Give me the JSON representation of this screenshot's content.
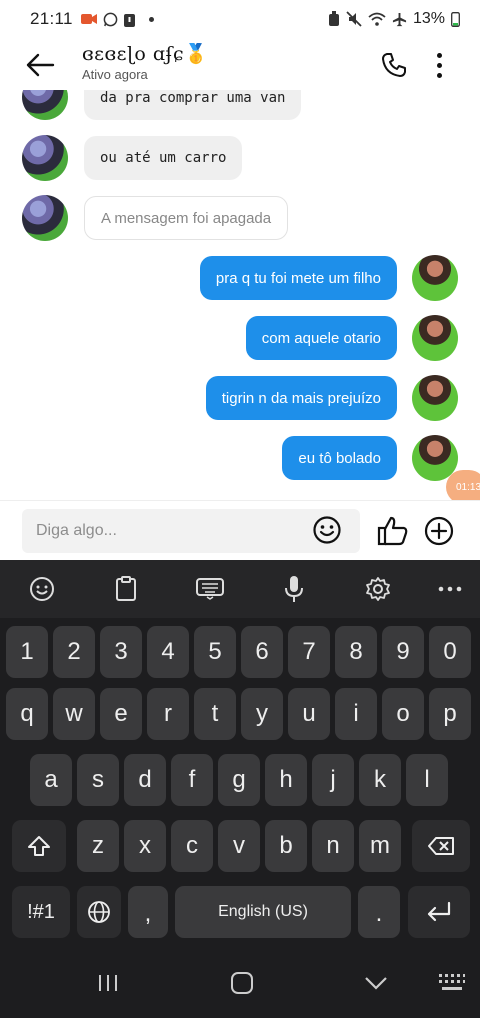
{
  "status": {
    "time": "21:11",
    "battery": "13%"
  },
  "header": {
    "title": "ɞɛɞɛɭo ɑʄɕ🥇",
    "subtitle": "Ativo agora"
  },
  "messages": [
    {
      "dir": "in",
      "text": "da pra comprar uma van"
    },
    {
      "dir": "in",
      "text": "ou até um carro"
    },
    {
      "dir": "in",
      "text": "A mensagem foi apagada",
      "deleted": true
    },
    {
      "dir": "out",
      "text": "pra q tu foi mete um filho"
    },
    {
      "dir": "out",
      "text": "com aquele otario"
    },
    {
      "dir": "out",
      "text": "tigrin n da mais prejuízo"
    },
    {
      "dir": "out",
      "text": "eu tô bolado"
    }
  ],
  "badge": "01:13",
  "composer": {
    "placeholder": "Diga algo..."
  },
  "keyboard": {
    "row_numbers": [
      "1",
      "2",
      "3",
      "4",
      "5",
      "6",
      "7",
      "8",
      "9",
      "0"
    ],
    "row1": [
      "q",
      "w",
      "e",
      "r",
      "t",
      "y",
      "u",
      "i",
      "o",
      "p"
    ],
    "row2": [
      "a",
      "s",
      "d",
      "f",
      "g",
      "h",
      "j",
      "k",
      "l"
    ],
    "row3": [
      "z",
      "x",
      "c",
      "v",
      "b",
      "n",
      "m"
    ],
    "symbols_label": "!#1",
    "comma": ",",
    "space_label": "English (US)",
    "period": "."
  },
  "colors": {
    "outgoing_bubble": "#1e8fea",
    "incoming_bubble": "#efefef",
    "keyboard_bg": "#1d1d1f",
    "key_bg": "#3a3a3c"
  }
}
